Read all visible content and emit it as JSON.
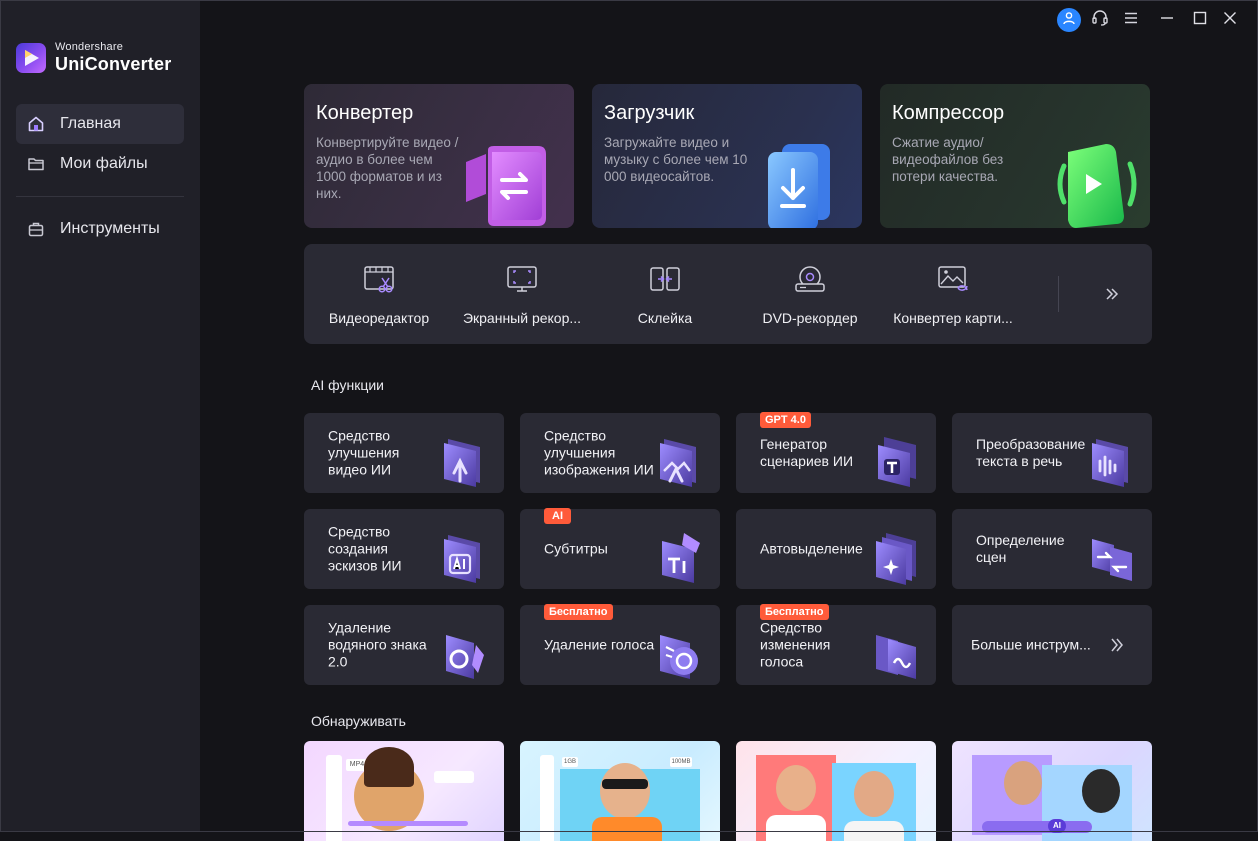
{
  "app": {
    "brand": "Wondershare",
    "product": "UniConverter"
  },
  "sidebar": {
    "items": [
      {
        "label": "Главная",
        "icon": "home-icon",
        "active": true
      },
      {
        "label": "Мои файлы",
        "icon": "folder-icon",
        "active": false
      },
      {
        "label": "Инструменты",
        "icon": "toolbox-icon",
        "active": false
      }
    ]
  },
  "titlebar": {
    "icons": [
      "user-icon",
      "headset-icon",
      "menu-icon",
      "minimize-icon",
      "maximize-icon",
      "close-icon"
    ],
    "accent": "#2a86ff"
  },
  "hero": [
    {
      "title": "Конвертер",
      "desc": "Конвертируйте видео / аудио в более чем 1000 форматов и из них.",
      "icon": "convert-icon"
    },
    {
      "title": "Загрузчик",
      "desc": "Загружайте видео и музыку с более чем 10 000 видеосайтов.",
      "icon": "download-icon"
    },
    {
      "title": "Компрессор",
      "desc": "Сжатие аудио/ видеофайлов без потери качества.",
      "icon": "compress-icon"
    }
  ],
  "tools": [
    {
      "label": "Видеоредактор",
      "icon": "video-editor-icon"
    },
    {
      "label": "Экранный рекор...",
      "icon": "screen-recorder-icon"
    },
    {
      "label": "Склейка",
      "icon": "merge-icon"
    },
    {
      "label": "DVD-рекордер",
      "icon": "dvd-icon"
    },
    {
      "label": "Конвертер карти...",
      "icon": "image-converter-icon"
    }
  ],
  "sections": {
    "ai": "AI функции",
    "discover": "Обнаруживать"
  },
  "ai_cards": [
    {
      "label": "Средство улучшения видео ИИ",
      "badge": "",
      "icon": "video-enhance-icon"
    },
    {
      "label": "Средство улучшения изображения ИИ",
      "badge": "",
      "icon": "image-enhance-icon"
    },
    {
      "label": "Генератор сценариев ИИ",
      "badge": "GPT 4.0",
      "icon": "script-generator-icon"
    },
    {
      "label": "Преобразование текста в речь",
      "badge": "",
      "icon": "text-to-speech-icon"
    },
    {
      "label": "Средство создания эскизов ИИ",
      "badge": "",
      "icon": "thumbnail-maker-icon"
    },
    {
      "label": "Субтитры",
      "badge": "AI",
      "icon": "subtitles-icon"
    },
    {
      "label": "Автовыделение",
      "badge": "",
      "icon": "auto-highlight-icon"
    },
    {
      "label": "Определение сцен",
      "badge": "",
      "icon": "scene-detection-icon"
    },
    {
      "label": "Удаление водяного знака 2.0",
      "badge": "",
      "icon": "watermark-remover-icon"
    },
    {
      "label": "Удаление голоса",
      "badge": "Бесплатно",
      "icon": "vocal-remover-icon"
    },
    {
      "label": "Средство изменения голоса",
      "badge": "Бесплатно",
      "icon": "voice-changer-icon"
    },
    {
      "label": "Больше инструм...",
      "badge": "",
      "icon": "chevron-double-right-icon"
    }
  ],
  "discover": {
    "cards": [
      {
        "tag": "MP4"
      },
      {
        "tag": "1GB",
        "tag2": "100MB"
      },
      {
        "tag": ""
      },
      {
        "tag": "AI"
      }
    ]
  }
}
